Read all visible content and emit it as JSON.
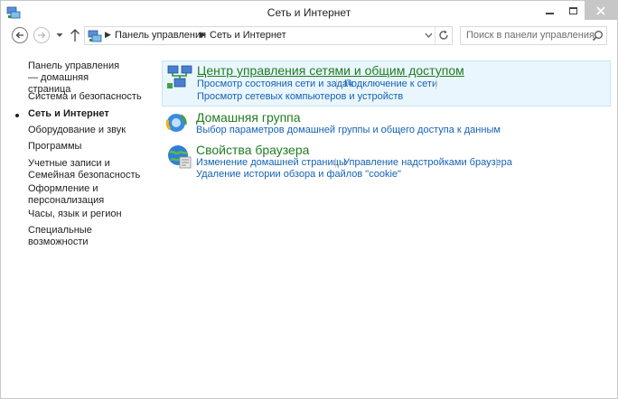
{
  "window": {
    "title": "Сеть и Интернет"
  },
  "navigation": {
    "back_icon": "back-arrow-icon",
    "forward_icon": "forward-arrow-icon",
    "up_icon": "up-arrow-icon",
    "breadcrumbs": [
      "Панель управления",
      "Сеть и Интернет"
    ],
    "search_placeholder": "Поиск в панели управления"
  },
  "sidebar": {
    "items": [
      {
        "label": "Панель управления — домашняя страница",
        "active": false
      },
      {
        "label": "Система и безопасность",
        "active": false
      },
      {
        "label": "Сеть и Интернет",
        "active": true
      },
      {
        "label": "Оборудование и звук",
        "active": false
      },
      {
        "label": "Программы",
        "active": false
      },
      {
        "label": "Учетные записи и Семейная безопасность",
        "active": false
      },
      {
        "label": "Оформление и персонализация",
        "active": false
      },
      {
        "label": "Часы, язык и регион",
        "active": false
      },
      {
        "label": "Специальные возможности",
        "active": false
      }
    ]
  },
  "categories": [
    {
      "icon": "network-center-icon",
      "title": "Центр управления сетями и общим доступом",
      "links": [
        "Просмотр состояния сети и задач",
        "Подключение к сети",
        "Просмотр сетевых компьютеров и устройств"
      ]
    },
    {
      "icon": "homegroup-icon",
      "title": "Домашняя группа",
      "links": [
        "Выбор параметров домашней группы и общего доступа к данным"
      ]
    },
    {
      "icon": "internet-options-icon",
      "title": "Свойства браузера",
      "links": [
        "Изменение домашней страницы",
        "Управление надстройками браузера",
        "Удаление истории обзора и файлов \"cookie\""
      ]
    }
  ],
  "colors": {
    "category_title": "#1f7d21",
    "link": "#1461b5",
    "selected_background": "#eaf6fd",
    "selected_border": "#c7e5f6"
  }
}
